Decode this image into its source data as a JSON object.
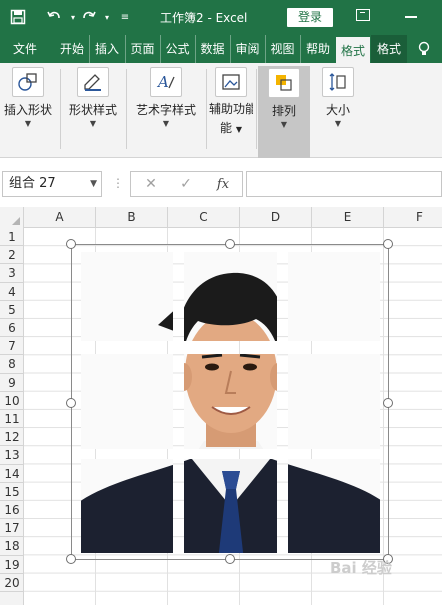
{
  "titlebar": {
    "doc_title": "工作簿2  -  Excel",
    "login_label": "登录",
    "icons": [
      "save-icon",
      "undo-icon",
      "redo-icon",
      "customize-quick-access-icon",
      "ribbon-display-options-icon",
      "minimize-icon"
    ]
  },
  "tabs": [
    "文件",
    "开始",
    "插入",
    "页面",
    "公式",
    "数据",
    "审阅",
    "视图",
    "帮助",
    "格式",
    "格式"
  ],
  "tell_me_icon": "lightbulb-icon",
  "ribbon": {
    "groups": [
      {
        "label": "插入形状",
        "icon": "shapes-icon"
      },
      {
        "label": "形状样式",
        "icon": "shape-style-icon"
      },
      {
        "label": "艺术字样式",
        "icon": "wordart-icon"
      },
      {
        "label": "辅助功能",
        "line2": "能",
        "icon": "alt-text-icon"
      },
      {
        "label": "排列",
        "icon": "arrange-icon"
      },
      {
        "label": "大小",
        "icon": "size-icon"
      }
    ]
  },
  "formula_bar": {
    "name_box": "组合 27",
    "formula_value": "",
    "buttons": [
      "cancel-icon",
      "enter-icon",
      "fx"
    ]
  },
  "grid": {
    "columns": [
      "A",
      "B",
      "C",
      "D",
      "E",
      "F"
    ],
    "rows": [
      "1",
      "2",
      "3",
      "4",
      "5",
      "6",
      "7",
      "8",
      "9",
      "10",
      "11",
      "12",
      "13",
      "14",
      "15",
      "16",
      "17",
      "18",
      "19",
      "20"
    ]
  },
  "picture": {
    "name": "group-27-puzzle-portrait",
    "colors": {
      "hair": "#1b1b1b",
      "skin": "#e2a982",
      "suit": "#1c2130",
      "shirt": "#f4f4f4",
      "tie": "#1e3a78",
      "bg": "#fafafa"
    }
  },
  "watermark": "Bai 经验"
}
